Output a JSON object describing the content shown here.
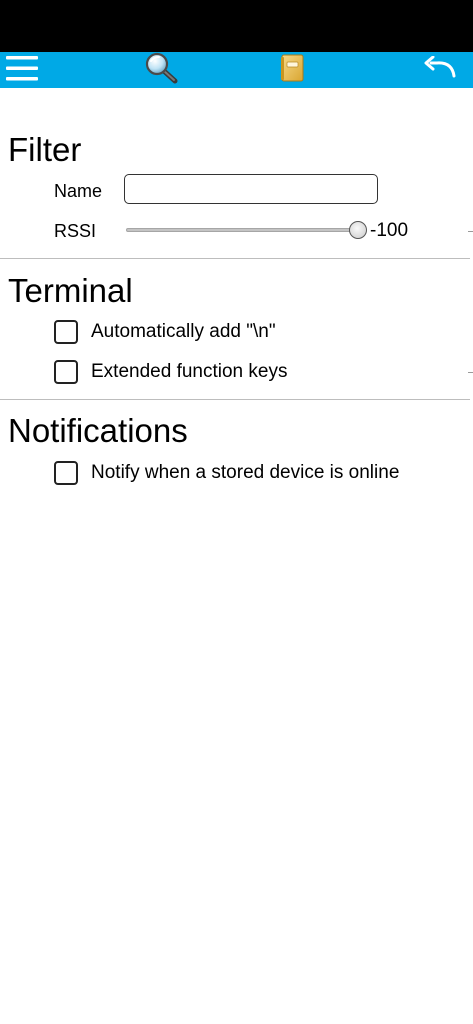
{
  "toolbar": {
    "menu_icon": "hamburger-menu-icon",
    "search_icon": "magnifier-search-icon",
    "book_icon": "stored-devices-book-icon",
    "back_icon": "undo-back-arrow-icon",
    "background_color": "#00a9e6"
  },
  "filter": {
    "title": "Filter",
    "name_label": "Name",
    "name_value": "",
    "rssi_label": "RSSI",
    "rssi_value": "-100",
    "rssi_slider_fraction": 1.0
  },
  "terminal": {
    "title": "Terminal",
    "options": [
      {
        "label": "Automatically add \"\\n\"",
        "checked": false
      },
      {
        "label": "Extended function keys",
        "checked": false
      }
    ]
  },
  "notifications": {
    "title": "Notifications",
    "options": [
      {
        "label": "Notify when a stored device is online",
        "checked": false
      }
    ]
  }
}
